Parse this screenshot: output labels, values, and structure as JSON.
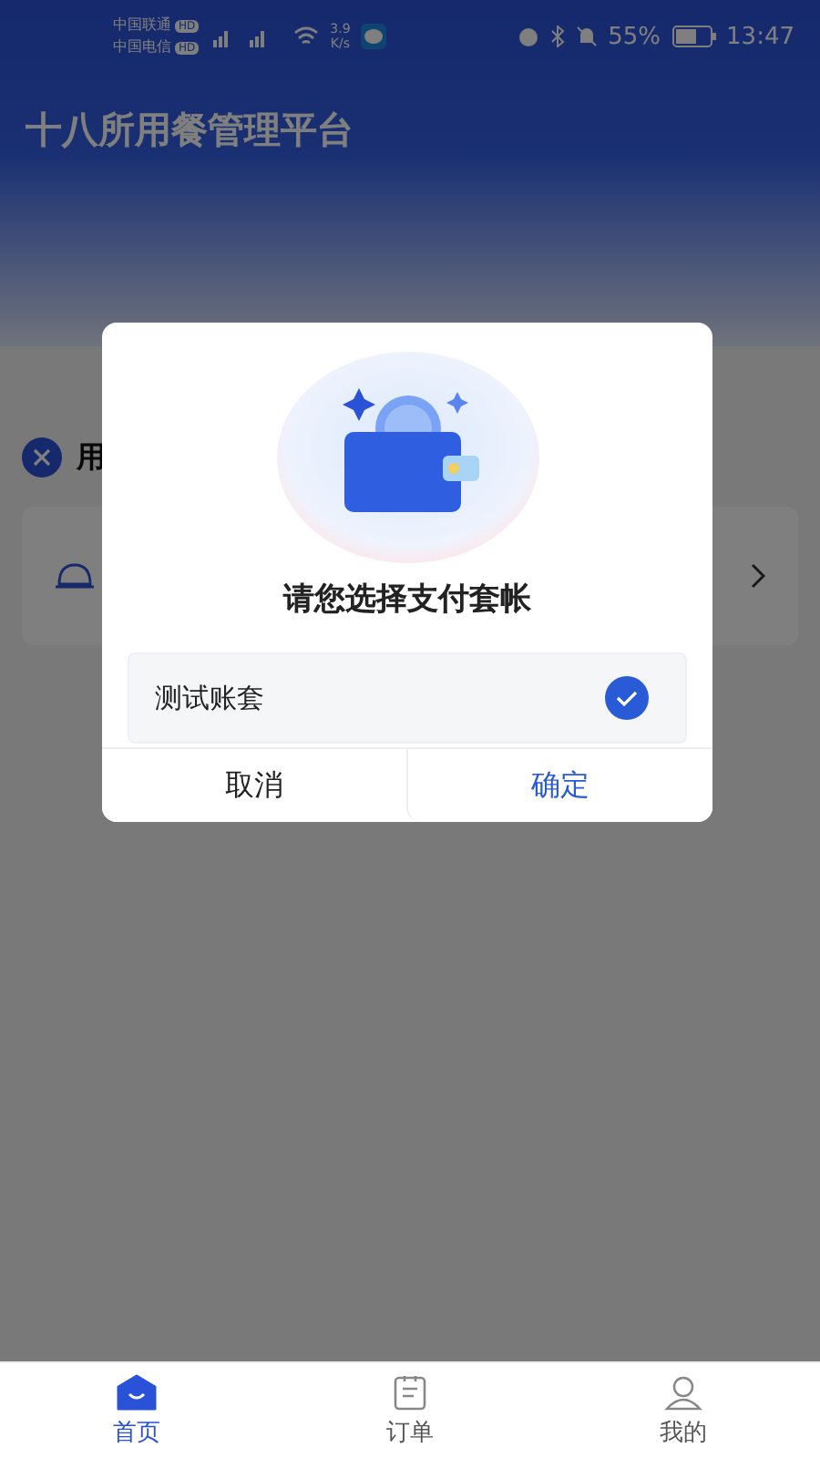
{
  "status_bar": {
    "carriers": [
      {
        "name": "中国联通",
        "badge": "HD"
      },
      {
        "name": "中国电信",
        "badge": "HD"
      }
    ],
    "speed_value": "3.9",
    "speed_unit": "K/s",
    "battery": "55%",
    "time": "13:47"
  },
  "header": {
    "title": "十八所用餐管理平台"
  },
  "section": {
    "title": "用"
  },
  "dialog": {
    "title": "请您选择支付套帐",
    "options": [
      {
        "label": "测试账套",
        "selected": true
      }
    ],
    "buttons": [
      {
        "label": "取消",
        "kind": "cancel"
      },
      {
        "label": "确定",
        "kind": "confirm"
      }
    ]
  },
  "tabs": [
    {
      "label": "首页",
      "kind": "home",
      "selected": true
    },
    {
      "label": "订单",
      "kind": "orders",
      "selected": false
    },
    {
      "label": "我的",
      "kind": "profile",
      "selected": false
    }
  ]
}
